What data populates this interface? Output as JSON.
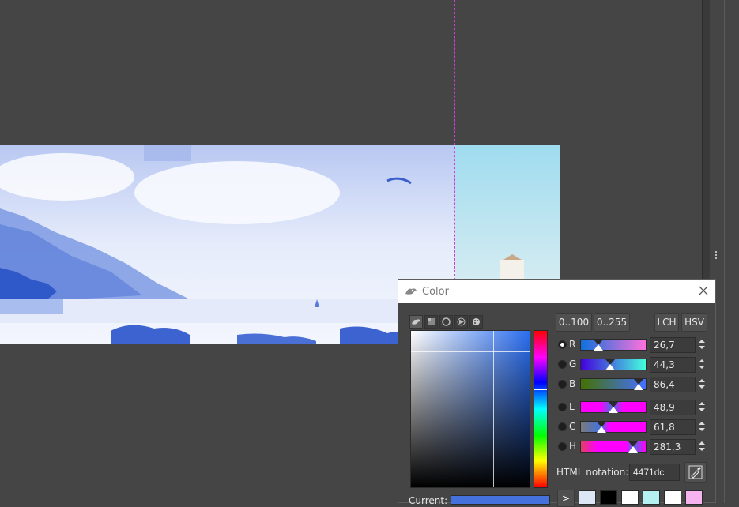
{
  "dialog": {
    "title": "Color",
    "icon": "wilber-icon",
    "close_icon": "close-icon"
  },
  "selector_tabs": [
    {
      "name": "gimp-selector-icon",
      "active": true
    },
    {
      "name": "cmyk-selector-icon",
      "active": false
    },
    {
      "name": "wheel-selector-icon",
      "active": false
    },
    {
      "name": "triangle-selector-icon",
      "active": false
    },
    {
      "name": "palette-selector-icon",
      "active": false
    }
  ],
  "scale_buttons": {
    "range_100": "0..100",
    "range_255": "0..255",
    "lch": "LCH",
    "hsv": "HSV"
  },
  "channels": [
    {
      "label": "R",
      "value": "26,7",
      "fraction": 0.267,
      "selected": true,
      "track": "linear-gradient(to right,#0d71dc,#ff71dc)"
    },
    {
      "label": "G",
      "value": "44,3",
      "fraction": 0.443,
      "selected": false,
      "track": "linear-gradient(to right,#4400dc,#44ffdc)"
    },
    {
      "label": "B",
      "value": "86,4",
      "fraction": 0.864,
      "selected": false,
      "track": "linear-gradient(to right,#447100,#4471ff)"
    },
    {
      "label": "L",
      "value": "48,9",
      "fraction": 0.489,
      "selected": false,
      "track": "linear-gradient(to right,#ff00ff 30%,#4471dc 48%,#ff00ff 66%)"
    },
    {
      "label": "C",
      "value": "61,8",
      "fraction": 0.309,
      "selected": false,
      "track": "linear-gradient(to right,#7a7a7a 0%,#4471dc 30%,#ff00ff 45%,#ff00ff 100%)"
    },
    {
      "label": "H",
      "value": "281,3",
      "fraction": 0.781,
      "selected": false,
      "track": "linear-gradient(to right,#e04060 0%,#ff00ff 25%,#ff00ff 70%,#4471dc 80%,#ff00ff 100%)"
    }
  ],
  "html_notation": {
    "label": "HTML notation:",
    "value": "4471dc"
  },
  "eyedropper_icon": "eyedropper-icon",
  "current": {
    "label": "Current:",
    "color": "#4471dc"
  },
  "history_arrow": ">",
  "history": [
    "#dde6f5",
    "#000000",
    "#ffffff",
    "#b6f1f1",
    "#ffffff",
    "#f5b3f0"
  ]
}
